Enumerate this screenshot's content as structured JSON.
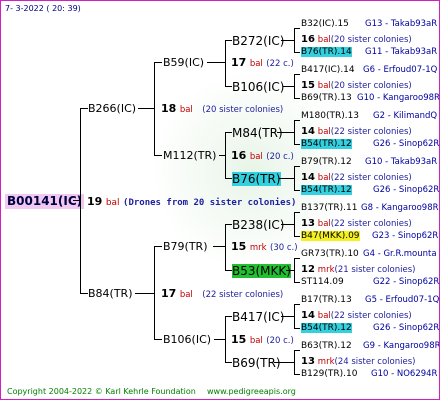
{
  "header": "7-  3-2022 ( 20: 39)",
  "root": {
    "id": "B00141(IC)",
    "num": "19",
    "bal": "bal",
    "drones": "(Drones from 20 sister colonies)"
  },
  "g1": [
    {
      "id": "B266(IC)",
      "num": "18",
      "mark": "bal",
      "sis": "(20 sister colonies)"
    },
    {
      "id": "B84(TR)",
      "num": "17",
      "mark": "bal",
      "sis": "(22 sister colonies)"
    }
  ],
  "g2": [
    {
      "id": "B59(IC)",
      "num": "17",
      "mark": "bal",
      "sis": "(22 c.)"
    },
    {
      "id": "M112(TR)",
      "num": "16",
      "mark": "bal",
      "sis": "(20 c.)"
    },
    {
      "id": "B79(TR)",
      "num": "15",
      "mark": "mrk",
      "sis": "(30 c.)"
    },
    {
      "id": "B106(IC)",
      "num": "15",
      "mark": "bal",
      "sis": "(20 c.)"
    }
  ],
  "g3": [
    {
      "id": "B272(IC)",
      "num": "16",
      "mark": "bal",
      "sis": "(20 sister colonies)"
    },
    {
      "id": "B106(IC)",
      "num": "15",
      "mark": "bal",
      "sis": "(20 sister colonies)"
    },
    {
      "id": "M84(TR)",
      "num": "14",
      "mark": "bal",
      "sis": "(22 sister colonies)"
    },
    {
      "id": "B76(TR)",
      "num": "14",
      "mark": "bal",
      "sis": "(22 sister colonies)"
    },
    {
      "id": "B238(IC)",
      "num": "13",
      "mark": "bal",
      "sis": "(22 sister colonies)"
    },
    {
      "id": "B53(MKK)",
      "num": "12",
      "mark": "mrk",
      "sis": "(21 sister colonies)"
    },
    {
      "id": "B417(IC)",
      "num": "14",
      "mark": "bal",
      "sis": "(22 sister colonies)"
    },
    {
      "id": "B69(TR)",
      "num": "13",
      "mark": "mrk",
      "sis": "(24 sister colonies)"
    }
  ],
  "g4": [
    {
      "id": "B32(IC).15",
      "info": "G13 - Takab93aR"
    },
    {
      "id": "B76(TR).14",
      "info": "G11 - Takab93aR"
    },
    {
      "id": "B417(IC).14",
      "info": "G6 - Erfoud07-1Q"
    },
    {
      "id": "B69(TR).13",
      "info": "G10 - Kangaroo98R"
    },
    {
      "id": "M180(TR).13",
      "info": "G2 - KilimandQ"
    },
    {
      "id": "B54(TR).12",
      "info": "G26 - Sinop62R"
    },
    {
      "id": "B79(TR).12",
      "info": "G10 - Takab93aR"
    },
    {
      "id": "B54(TR).12",
      "info": "G26 - Sinop62R"
    },
    {
      "id": "B137(TR).11",
      "info": "G8 - Kangaroo98R"
    },
    {
      "id": "B47(MKK).09",
      "info": "G23 - Sinop62R"
    },
    {
      "id": "GR73(TR).10",
      "info": "G4 - Gr.R.mounta"
    },
    {
      "id": "ST114.09",
      "info": "G22 - Sinop62R"
    },
    {
      "id": "B17(TR).13",
      "info": "G5 - Erfoud07-1Q"
    },
    {
      "id": "B54(TR).12",
      "info": "G26 - Sinop62R"
    },
    {
      "id": "B63(TR).12",
      "info": "G9 - Kangaroo98R"
    },
    {
      "id": "B129(TR).10",
      "info": "G10 - NO6294R"
    }
  ],
  "footer": {
    "copyright": "Copyright 2004-2022 © Karl Kehrle Foundation",
    "site": "www.pedigreeapis.org"
  },
  "colors": {
    "frame": "#d020c0",
    "highlight_cyan": "#33d0e0",
    "highlight_yellow": "#f5f020",
    "highlight_green": "#22c030",
    "root_bg": "#f0c8f0",
    "footer": "#008000"
  }
}
